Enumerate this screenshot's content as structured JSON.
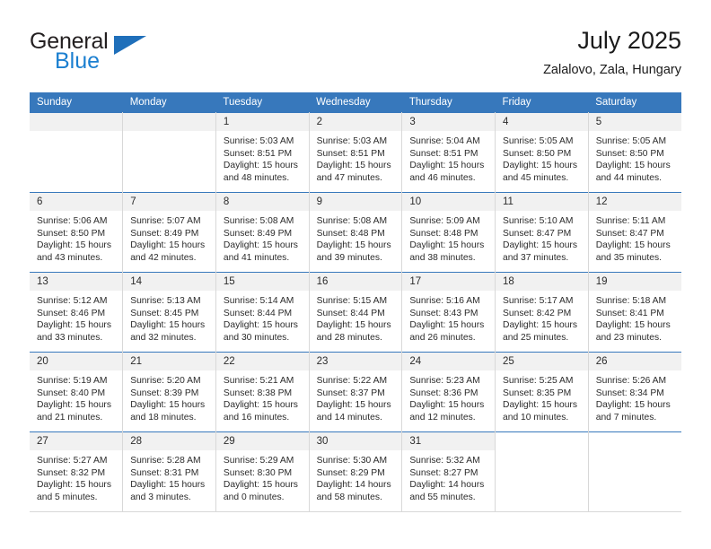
{
  "logo": {
    "word1": "General",
    "word2": "Blue",
    "triangle_color": "#1f6fba",
    "blue_color": "#1b7fd0"
  },
  "header": {
    "title": "July 2025",
    "subtitle": "Zalalovo, Zala, Hungary"
  },
  "theme": {
    "header_bg": "#3778bc",
    "daynum_bg": "#f1f1f1",
    "cell_border": "#d8d8d8"
  },
  "weekdays": [
    "Sunday",
    "Monday",
    "Tuesday",
    "Wednesday",
    "Thursday",
    "Friday",
    "Saturday"
  ],
  "weeks": [
    [
      {
        "day": "",
        "empty": true
      },
      {
        "day": "",
        "empty": true
      },
      {
        "day": "1",
        "sunrise": "Sunrise: 5:03 AM",
        "sunset": "Sunset: 8:51 PM",
        "daylight1": "Daylight: 15 hours",
        "daylight2": "and 48 minutes."
      },
      {
        "day": "2",
        "sunrise": "Sunrise: 5:03 AM",
        "sunset": "Sunset: 8:51 PM",
        "daylight1": "Daylight: 15 hours",
        "daylight2": "and 47 minutes."
      },
      {
        "day": "3",
        "sunrise": "Sunrise: 5:04 AM",
        "sunset": "Sunset: 8:51 PM",
        "daylight1": "Daylight: 15 hours",
        "daylight2": "and 46 minutes."
      },
      {
        "day": "4",
        "sunrise": "Sunrise: 5:05 AM",
        "sunset": "Sunset: 8:50 PM",
        "daylight1": "Daylight: 15 hours",
        "daylight2": "and 45 minutes."
      },
      {
        "day": "5",
        "sunrise": "Sunrise: 5:05 AM",
        "sunset": "Sunset: 8:50 PM",
        "daylight1": "Daylight: 15 hours",
        "daylight2": "and 44 minutes."
      }
    ],
    [
      {
        "day": "6",
        "sunrise": "Sunrise: 5:06 AM",
        "sunset": "Sunset: 8:50 PM",
        "daylight1": "Daylight: 15 hours",
        "daylight2": "and 43 minutes."
      },
      {
        "day": "7",
        "sunrise": "Sunrise: 5:07 AM",
        "sunset": "Sunset: 8:49 PM",
        "daylight1": "Daylight: 15 hours",
        "daylight2": "and 42 minutes."
      },
      {
        "day": "8",
        "sunrise": "Sunrise: 5:08 AM",
        "sunset": "Sunset: 8:49 PM",
        "daylight1": "Daylight: 15 hours",
        "daylight2": "and 41 minutes."
      },
      {
        "day": "9",
        "sunrise": "Sunrise: 5:08 AM",
        "sunset": "Sunset: 8:48 PM",
        "daylight1": "Daylight: 15 hours",
        "daylight2": "and 39 minutes."
      },
      {
        "day": "10",
        "sunrise": "Sunrise: 5:09 AM",
        "sunset": "Sunset: 8:48 PM",
        "daylight1": "Daylight: 15 hours",
        "daylight2": "and 38 minutes."
      },
      {
        "day": "11",
        "sunrise": "Sunrise: 5:10 AM",
        "sunset": "Sunset: 8:47 PM",
        "daylight1": "Daylight: 15 hours",
        "daylight2": "and 37 minutes."
      },
      {
        "day": "12",
        "sunrise": "Sunrise: 5:11 AM",
        "sunset": "Sunset: 8:47 PM",
        "daylight1": "Daylight: 15 hours",
        "daylight2": "and 35 minutes."
      }
    ],
    [
      {
        "day": "13",
        "sunrise": "Sunrise: 5:12 AM",
        "sunset": "Sunset: 8:46 PM",
        "daylight1": "Daylight: 15 hours",
        "daylight2": "and 33 minutes."
      },
      {
        "day": "14",
        "sunrise": "Sunrise: 5:13 AM",
        "sunset": "Sunset: 8:45 PM",
        "daylight1": "Daylight: 15 hours",
        "daylight2": "and 32 minutes."
      },
      {
        "day": "15",
        "sunrise": "Sunrise: 5:14 AM",
        "sunset": "Sunset: 8:44 PM",
        "daylight1": "Daylight: 15 hours",
        "daylight2": "and 30 minutes."
      },
      {
        "day": "16",
        "sunrise": "Sunrise: 5:15 AM",
        "sunset": "Sunset: 8:44 PM",
        "daylight1": "Daylight: 15 hours",
        "daylight2": "and 28 minutes."
      },
      {
        "day": "17",
        "sunrise": "Sunrise: 5:16 AM",
        "sunset": "Sunset: 8:43 PM",
        "daylight1": "Daylight: 15 hours",
        "daylight2": "and 26 minutes."
      },
      {
        "day": "18",
        "sunrise": "Sunrise: 5:17 AM",
        "sunset": "Sunset: 8:42 PM",
        "daylight1": "Daylight: 15 hours",
        "daylight2": "and 25 minutes."
      },
      {
        "day": "19",
        "sunrise": "Sunrise: 5:18 AM",
        "sunset": "Sunset: 8:41 PM",
        "daylight1": "Daylight: 15 hours",
        "daylight2": "and 23 minutes."
      }
    ],
    [
      {
        "day": "20",
        "sunrise": "Sunrise: 5:19 AM",
        "sunset": "Sunset: 8:40 PM",
        "daylight1": "Daylight: 15 hours",
        "daylight2": "and 21 minutes."
      },
      {
        "day": "21",
        "sunrise": "Sunrise: 5:20 AM",
        "sunset": "Sunset: 8:39 PM",
        "daylight1": "Daylight: 15 hours",
        "daylight2": "and 18 minutes."
      },
      {
        "day": "22",
        "sunrise": "Sunrise: 5:21 AM",
        "sunset": "Sunset: 8:38 PM",
        "daylight1": "Daylight: 15 hours",
        "daylight2": "and 16 minutes."
      },
      {
        "day": "23",
        "sunrise": "Sunrise: 5:22 AM",
        "sunset": "Sunset: 8:37 PM",
        "daylight1": "Daylight: 15 hours",
        "daylight2": "and 14 minutes."
      },
      {
        "day": "24",
        "sunrise": "Sunrise: 5:23 AM",
        "sunset": "Sunset: 8:36 PM",
        "daylight1": "Daylight: 15 hours",
        "daylight2": "and 12 minutes."
      },
      {
        "day": "25",
        "sunrise": "Sunrise: 5:25 AM",
        "sunset": "Sunset: 8:35 PM",
        "daylight1": "Daylight: 15 hours",
        "daylight2": "and 10 minutes."
      },
      {
        "day": "26",
        "sunrise": "Sunrise: 5:26 AM",
        "sunset": "Sunset: 8:34 PM",
        "daylight1": "Daylight: 15 hours",
        "daylight2": "and 7 minutes."
      }
    ],
    [
      {
        "day": "27",
        "sunrise": "Sunrise: 5:27 AM",
        "sunset": "Sunset: 8:32 PM",
        "daylight1": "Daylight: 15 hours",
        "daylight2": "and 5 minutes."
      },
      {
        "day": "28",
        "sunrise": "Sunrise: 5:28 AM",
        "sunset": "Sunset: 8:31 PM",
        "daylight1": "Daylight: 15 hours",
        "daylight2": "and 3 minutes."
      },
      {
        "day": "29",
        "sunrise": "Sunrise: 5:29 AM",
        "sunset": "Sunset: 8:30 PM",
        "daylight1": "Daylight: 15 hours",
        "daylight2": "and 0 minutes."
      },
      {
        "day": "30",
        "sunrise": "Sunrise: 5:30 AM",
        "sunset": "Sunset: 8:29 PM",
        "daylight1": "Daylight: 14 hours",
        "daylight2": "and 58 minutes."
      },
      {
        "day": "31",
        "sunrise": "Sunrise: 5:32 AM",
        "sunset": "Sunset: 8:27 PM",
        "daylight1": "Daylight: 14 hours",
        "daylight2": "and 55 minutes."
      },
      {
        "day": "",
        "empty": true,
        "blank": true
      },
      {
        "day": "",
        "empty": true,
        "blank": true
      }
    ]
  ]
}
